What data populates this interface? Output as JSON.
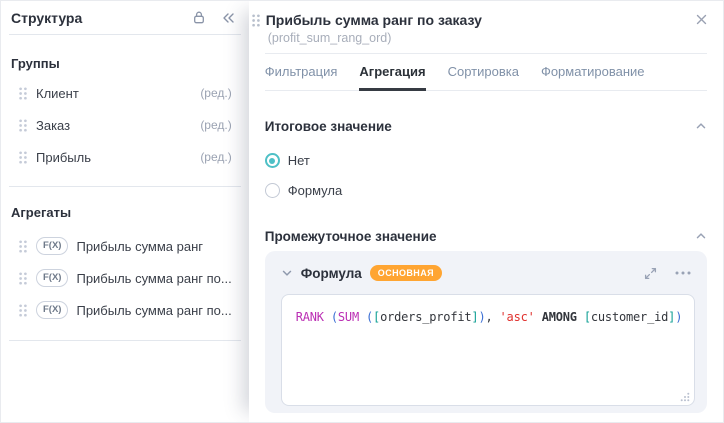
{
  "colors": {
    "accent_teal": "#4ec0c6",
    "badge_orange": "#ffa532",
    "tab_active": "#2b3138",
    "tab_inactive": "#8091a8",
    "icon_gray": "#99a2b5",
    "card_bg": "#f1f3f8",
    "syntax": {
      "function": "#bb2fb4",
      "paren": "#3b6fd4",
      "bracket": "#0e9f93",
      "string": "#e0312e",
      "keyword": "#33363c",
      "field": "#33363c",
      "plain": "#33363c"
    }
  },
  "sidebar": {
    "title": "Структура",
    "header_icons": [
      "lock-icon",
      "collapse-sidebar-icon"
    ],
    "groups": {
      "title": "Группы",
      "edit_label": "(ред.)",
      "items": [
        {
          "label": "Клиент"
        },
        {
          "label": "Заказ"
        },
        {
          "label": "Прибыль"
        }
      ]
    },
    "aggregates": {
      "title": "Агрегаты",
      "badge": "F(X)",
      "items": [
        {
          "label": "Прибыль сумма ранг"
        },
        {
          "label": "Прибыль сумма ранг по..."
        },
        {
          "label": "Прибыль сумма ранг по..."
        }
      ]
    }
  },
  "panel": {
    "title": "Прибыль сумма ранг по заказу",
    "subtitle": "(profit_sum_rang_ord)",
    "tabs": [
      {
        "label": "Фильтрация",
        "active": false
      },
      {
        "label": "Агрегация",
        "active": true
      },
      {
        "label": "Сортировка",
        "active": false
      },
      {
        "label": "Форматирование",
        "active": false
      }
    ],
    "total_section": {
      "title": "Итоговое значение",
      "options": [
        {
          "label": "Нет",
          "selected": true
        },
        {
          "label": "Формула",
          "selected": false
        }
      ]
    },
    "intermediate_section": {
      "title": "Промежуточное значение",
      "formula_card": {
        "title": "Формула",
        "badge": "ОСНОВНАЯ",
        "formula_text": "RANK (SUM ([orders_profit]), 'asc' AMONG [customer_id])",
        "formula_tokens": [
          {
            "t": "RANK",
            "c": "function"
          },
          {
            "t": " ",
            "c": "plain"
          },
          {
            "t": "(",
            "c": "paren"
          },
          {
            "t": "SUM",
            "c": "function"
          },
          {
            "t": " ",
            "c": "plain"
          },
          {
            "t": "(",
            "c": "paren"
          },
          {
            "t": "[",
            "c": "bracket"
          },
          {
            "t": "orders_profit",
            "c": "field"
          },
          {
            "t": "]",
            "c": "bracket"
          },
          {
            "t": ")",
            "c": "paren"
          },
          {
            "t": ", ",
            "c": "plain"
          },
          {
            "t": "'asc'",
            "c": "string"
          },
          {
            "t": " ",
            "c": "plain"
          },
          {
            "t": "AMONG",
            "c": "keyword"
          },
          {
            "t": " ",
            "c": "plain"
          },
          {
            "t": "[",
            "c": "bracket"
          },
          {
            "t": "customer_id",
            "c": "field"
          },
          {
            "t": "]",
            "c": "bracket"
          },
          {
            "t": ")",
            "c": "paren"
          }
        ]
      }
    }
  }
}
